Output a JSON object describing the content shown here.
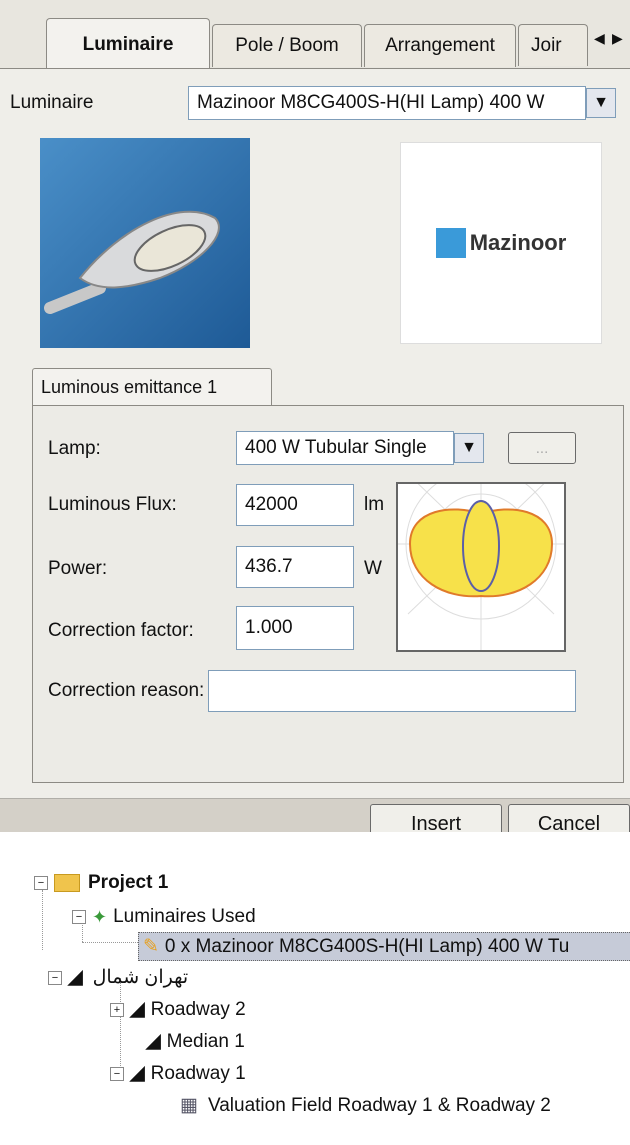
{
  "tabs": [
    "Luminaire",
    "Pole / Boom",
    "Arrangement",
    "Joir"
  ],
  "luminaire_label": "Luminaire",
  "luminaire_value": "Mazinoor M8CG400S-H(HI Lamp) 400 W",
  "brand_logo": "Mazinoor",
  "inner_tab": "Luminous emittance 1",
  "lamp_label": "Lamp:",
  "lamp_value": "400 W Tubular Single",
  "lamp_more": "...",
  "flux_label": "Luminous Flux:",
  "flux_value": "42000",
  "flux_unit": "lm",
  "power_label": "Power:",
  "power_value": "436.7",
  "power_unit": "W",
  "correction_factor_label": "Correction factor:",
  "correction_factor_value": "1.000",
  "correction_reason_label": "Correction reason:",
  "correction_reason_value": "",
  "insert_label": "Insert",
  "cancel_label": "Cancel",
  "tree": {
    "project": "Project 1",
    "luminaires_used": "Luminaires Used",
    "luminaire_item": "0 x Mazinoor M8CG400S-H(HI Lamp) 400 W Tu",
    "street": "تهران شمال",
    "roadway2": "Roadway 2",
    "median1": "Median 1",
    "roadway1": "Roadway 1",
    "valuation": "Valuation Field Roadway 1 & Roadway 2"
  },
  "colors": {
    "accent": "#f7e14a",
    "tree_selection": "#c6cbd8",
    "folder": "#f0c44c"
  }
}
